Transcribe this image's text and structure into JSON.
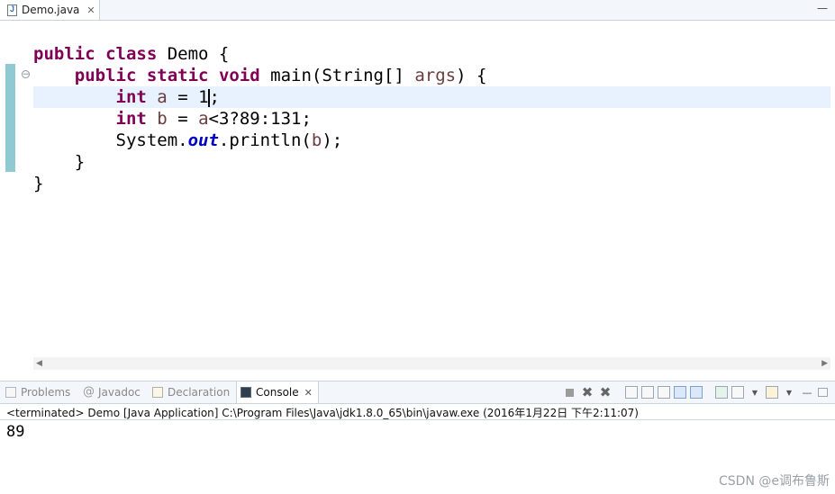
{
  "editor": {
    "tab_title": "Demo.java",
    "tab_close": "✕",
    "minimize": "—",
    "code": {
      "line1": {
        "kw1": "public",
        "kw2": "class",
        "rest": " Demo {"
      },
      "line2": {
        "indent": "    ",
        "kw1": "public",
        "kw2": "static",
        "kw3": "void",
        "rest1": " main(String[] ",
        "var": "args",
        "rest2": ") {"
      },
      "line3": {
        "indent": "        ",
        "kw": "int",
        "sp": " ",
        "var": "a",
        "rest1": " = ",
        "value": "1",
        "rest2": ";"
      },
      "line4": {
        "indent": "        ",
        "kw": "int",
        "sp": " ",
        "var": "b",
        "rest1": " = ",
        "var2": "a",
        "rest2": "<3?89:131;"
      },
      "line5": {
        "indent": "        ",
        "rest1": "System.",
        "field": "out",
        "rest2": ".println(",
        "var": "b",
        "rest3": ");"
      },
      "line6": "    }",
      "line7": "}"
    }
  },
  "panel": {
    "tabs": [
      {
        "label": "Problems"
      },
      {
        "label": "Javadoc"
      },
      {
        "label": "Declaration"
      },
      {
        "label": "Console",
        "close": "✕"
      }
    ],
    "console_status": "<terminated> Demo [Java Application] C:\\Program Files\\Java\\jdk1.8.0_65\\bin\\javaw.exe (2016年1月22日 下午2:11:07)",
    "console_output": "89"
  },
  "watermark": "CSDN @e调布鲁斯",
  "icons": [
    "java-file-icon",
    "fold-icon",
    "problems-icon",
    "javadoc-icon",
    "declaration-icon",
    "console-icon",
    "terminate-icon",
    "remove-launch-icon",
    "remove-all-icon",
    "clear-console-icon",
    "scroll-lock-icon",
    "word-wrap-icon",
    "show-stdout-icon",
    "show-stderr-icon",
    "pin-console-icon",
    "display-console-icon",
    "open-console-icon",
    "minimize-icon",
    "maximize-icon"
  ]
}
